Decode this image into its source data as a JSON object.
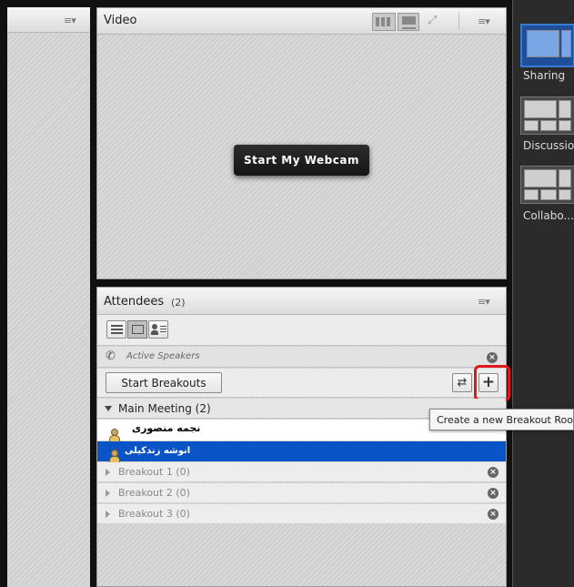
{
  "left_panel": {
    "menu_icon": "menu-icon"
  },
  "video_pod": {
    "title": "Video",
    "start_webcam_label": "Start My Webcam",
    "icons": [
      "grid-view-icon",
      "filmstrip-view-icon",
      "fullscreen-icon",
      "menu-icon"
    ]
  },
  "attendees_pod": {
    "title": "Attendees",
    "count": "(2)",
    "view_buttons": [
      "list-view-icon",
      "breakout-view-icon",
      "presenter-view-icon"
    ],
    "active_speakers_label": "Active Speakers",
    "start_breakouts_label": "Start Breakouts",
    "main_meeting": {
      "label": "Main Meeting (2)"
    },
    "attendees": [
      {
        "name": "نجمه منصوری",
        "selected": false
      },
      {
        "name": "انوشه زندکیلی",
        "selected": true
      }
    ],
    "breakouts": [
      {
        "label": "Breakout 1 (0)"
      },
      {
        "label": "Breakout 2 (0)"
      },
      {
        "label": "Breakout 3 (0)"
      }
    ],
    "tooltip": "Create a new Breakout Room"
  },
  "layouts": [
    {
      "label": "Sharing",
      "active": true
    },
    {
      "label": "Discussion",
      "active": false
    },
    {
      "label": "Collabo...",
      "active": false
    }
  ],
  "colors": {
    "selected_row": "#0a54c8",
    "highlight_box": "#e0191b",
    "dark_sidebar": "#2b2b2b",
    "accent_active": "#3a7bd5"
  }
}
